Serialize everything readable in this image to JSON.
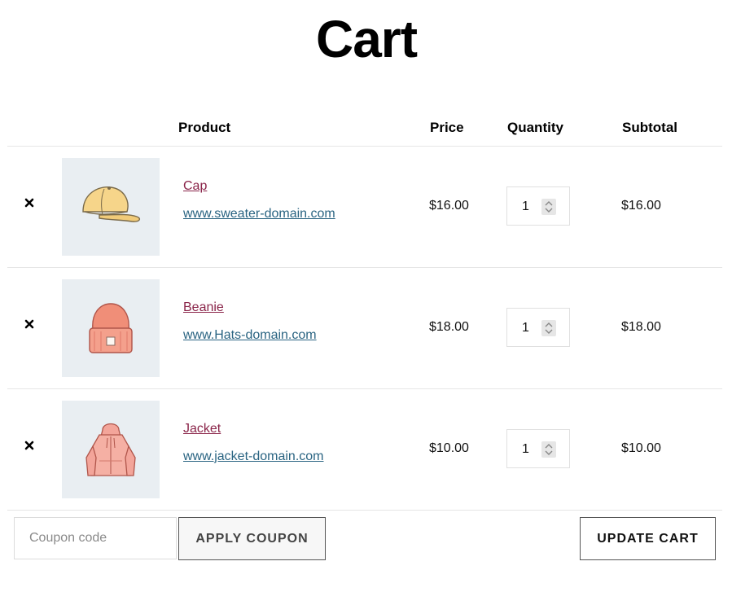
{
  "page": {
    "title": "Cart"
  },
  "table": {
    "headers": {
      "product": "Product",
      "price": "Price",
      "quantity": "Quantity",
      "subtotal": "Subtotal"
    },
    "items": [
      {
        "name": "Cap",
        "link": "www.sweater-domain.com",
        "price": "$16.00",
        "quantity": "1",
        "subtotal": "$16.00",
        "image_icon": "cap-icon"
      },
      {
        "name": "Beanie",
        "link": "www.Hats-domain.com",
        "price": "$18.00",
        "quantity": "1",
        "subtotal": "$18.00",
        "image_icon": "beanie-icon"
      },
      {
        "name": "Jacket",
        "link": "www.jacket-domain.com",
        "price": "$10.00",
        "quantity": "1",
        "subtotal": "$10.00",
        "image_icon": "hoodie-icon"
      }
    ]
  },
  "actions": {
    "coupon_placeholder": "Coupon code",
    "apply_coupon_label": "APPLY COUPON",
    "update_cart_label": "UPDATE CART"
  },
  "colors": {
    "product_link": "#8a2449",
    "url_link": "#2a6482",
    "thumb_bg": "#e9eef2"
  }
}
